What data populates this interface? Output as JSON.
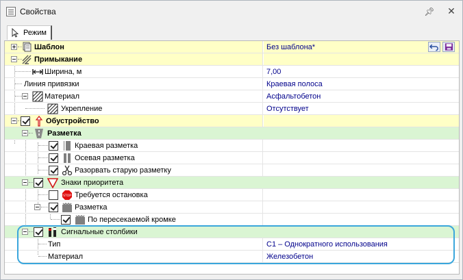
{
  "window": {
    "title": "Свойства"
  },
  "tabs": [
    {
      "label": "Режим"
    }
  ],
  "rows": [
    {
      "label": "Шаблон",
      "value": "Без шаблона*"
    },
    {
      "label": "Примыкание",
      "value": ""
    },
    {
      "label": "Ширина, м",
      "value": "7,00"
    },
    {
      "label": "Линия привязки",
      "value": "Краевая полоса"
    },
    {
      "label": "Материал",
      "value": "Асфальтобетон"
    },
    {
      "label": "Укрепление",
      "value": "Отсутствует"
    },
    {
      "label": "Обустройство",
      "value": ""
    },
    {
      "label": "Разметка",
      "value": ""
    },
    {
      "label": "Краевая разметка",
      "value": ""
    },
    {
      "label": "Осевая разметка",
      "value": ""
    },
    {
      "label": "Разорвать старую разметку",
      "value": ""
    },
    {
      "label": "Знаки приоритета",
      "value": ""
    },
    {
      "label": "Требуется остановка",
      "value": ""
    },
    {
      "label": "Разметка",
      "value": ""
    },
    {
      "label": "По пересекаемой кромке",
      "value": ""
    },
    {
      "label": "Сигнальные столбики",
      "value": ""
    },
    {
      "label": "Тип",
      "value": "С1 – Однократного использования"
    },
    {
      "label": "Материал",
      "value": "Железобетон"
    }
  ],
  "colors": {
    "accent": "#3aa6dc",
    "value_text": "#00008b",
    "yellow_row": "#ffffc6",
    "green_row": "#daf5d3"
  }
}
